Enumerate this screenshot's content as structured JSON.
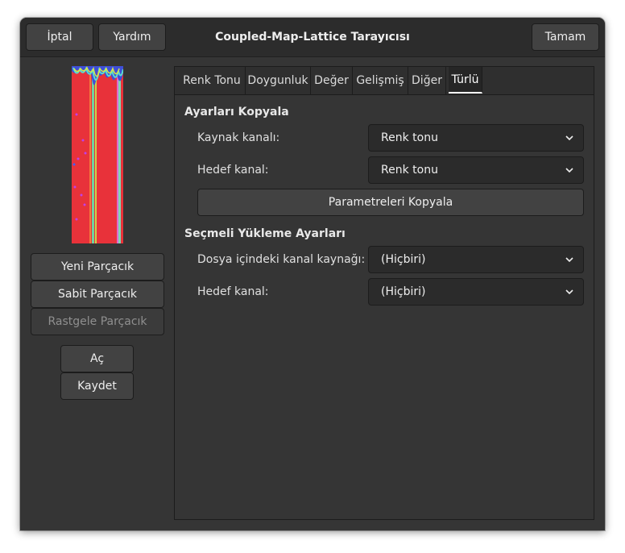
{
  "header": {
    "cancel_label": "İptal",
    "help_label": "Yardım",
    "title": "Coupled-Map-Lattice Tarayıcısı",
    "ok_label": "Tamam"
  },
  "sidebar": {
    "new_seed_label": "Yeni Parçacık",
    "fixed_seed_label": "Sabit Parçacık",
    "random_seed_label": "Rastgele Parçacık",
    "open_label": "Aç",
    "save_label": "Kaydet"
  },
  "tabs": [
    "Renk Tonu",
    "Doygunluk",
    "Değer",
    "Gelişmiş",
    "Diğer",
    "Türlü"
  ],
  "active_tab": "Türlü",
  "copy_section": {
    "title": "Ayarları Kopyala",
    "source_label": "Kaynak kanalı:",
    "source_value": "Renk tonu",
    "dest_label": "Hedef kanal:",
    "dest_value": "Renk tonu",
    "copy_button": "Parametreleri Kopyala"
  },
  "load_section": {
    "title": "Seçmeli Yükleme Ayarları",
    "file_source_label": "Dosya içindeki kanal kaynağı:",
    "file_source_value": "(Hiçbiri)",
    "dest_label": "Hedef kanal:",
    "dest_value": "(Hiçbiri)"
  },
  "colors": {
    "preview_red": "#e8323a",
    "window_bg": "#353535"
  }
}
